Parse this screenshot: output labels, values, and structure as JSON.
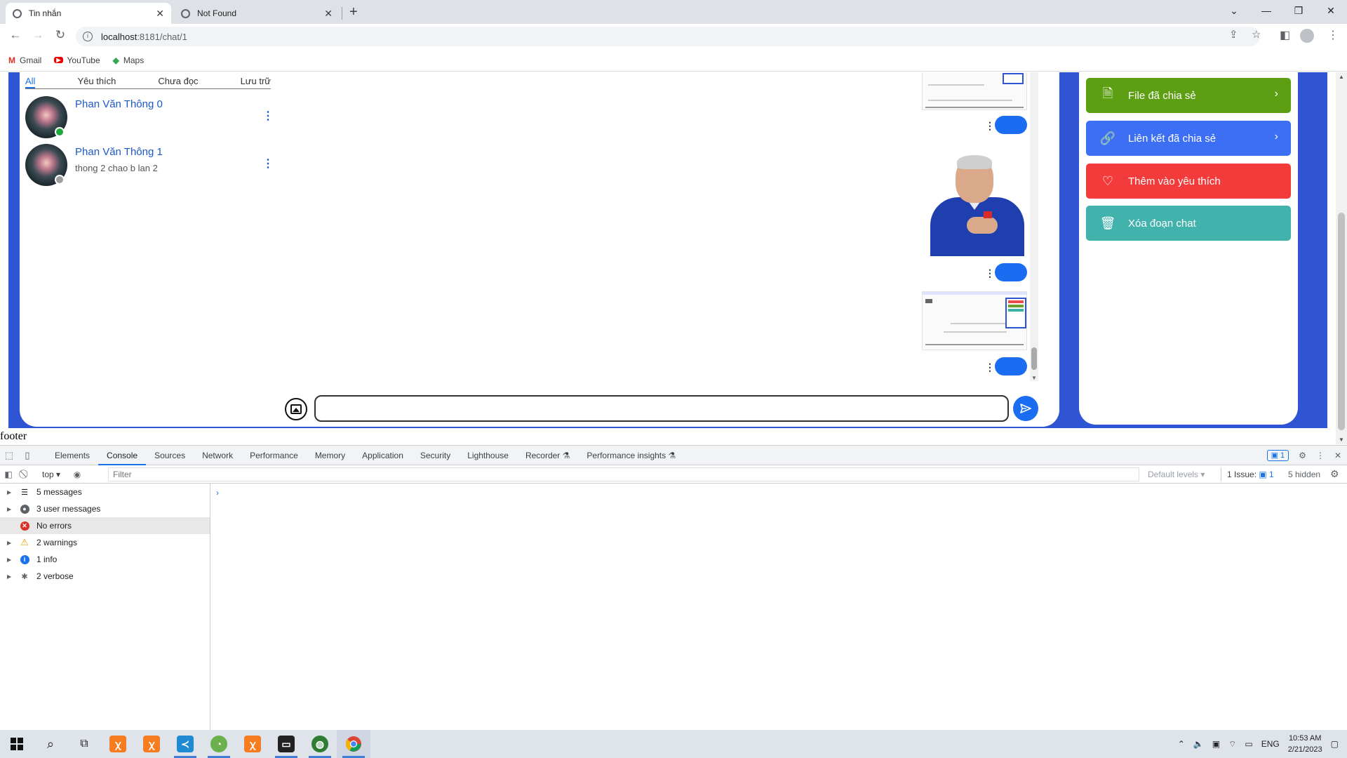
{
  "browser": {
    "tabs": [
      {
        "title": "Tin nhắn",
        "active": true
      },
      {
        "title": "Not Found",
        "active": false
      }
    ],
    "url_host": "localhost",
    "url_rest": ":8181/chat/1",
    "bookmarks": [
      {
        "label": "Gmail",
        "icon": "gmail-icon"
      },
      {
        "label": "YouTube",
        "icon": "youtube-icon"
      },
      {
        "label": "Maps",
        "icon": "maps-icon"
      }
    ]
  },
  "chat": {
    "filter_tabs": [
      "All",
      "Yêu thích",
      "Chưa đọc",
      "Lưu trữ"
    ],
    "active_filter": "All",
    "conversations": [
      {
        "name": "Phan Văn Thông 0",
        "preview": "",
        "online": true
      },
      {
        "name": "Phan Văn Thông 1",
        "preview": "thong 2 chao b lan 2",
        "online": false
      }
    ],
    "message_input": {
      "value": "",
      "placeholder": ""
    }
  },
  "sidebar_actions": [
    {
      "label": "File đã chia sẻ",
      "icon": "file-image-icon",
      "color": "#5d9f12",
      "chevron": true
    },
    {
      "label": "Liên kết đã chia sẻ",
      "icon": "link-icon",
      "color": "#3d6ff5",
      "chevron": true
    },
    {
      "label": "Thêm vào yêu thích",
      "icon": "heart-icon",
      "color": "#f43b3b",
      "chevron": false
    },
    {
      "label": "Xóa đoạn chat",
      "icon": "trash-icon",
      "color": "#42b2ad",
      "chevron": false
    }
  ],
  "footer": "footer",
  "devtools": {
    "tabs": [
      "Elements",
      "Console",
      "Sources",
      "Network",
      "Performance",
      "Memory",
      "Application",
      "Security",
      "Lighthouse",
      "Recorder",
      "Performance insights"
    ],
    "active_tab": "Console",
    "issues_badge": "1",
    "context": "top",
    "filter_placeholder": "Filter",
    "default_levels": "Default levels",
    "issues_label": "1 Issue:",
    "issues_count": "1",
    "hidden": "5 hidden",
    "sidebar": [
      {
        "label": "5 messages",
        "icon": "list-icon"
      },
      {
        "label": "3 user messages",
        "icon": "user-icon"
      },
      {
        "label": "No errors",
        "icon": "error-icon"
      },
      {
        "label": "2 warnings",
        "icon": "warning-icon"
      },
      {
        "label": "1 info",
        "icon": "info-icon"
      },
      {
        "label": "2 verbose",
        "icon": "bug-icon"
      }
    ]
  },
  "taskbar": {
    "time": "10:53 AM",
    "date": "2/21/2023",
    "lang": "ENG"
  }
}
